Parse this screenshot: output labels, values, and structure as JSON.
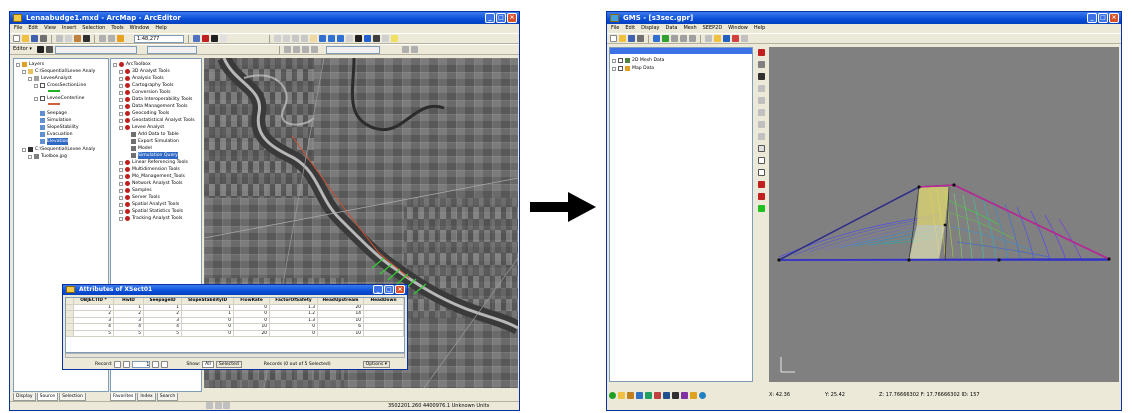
{
  "arcmap": {
    "title": "Lenaabudge1.mxd - ArcMap - ArcEditor",
    "menu": [
      "File",
      "Edit",
      "View",
      "Insert",
      "Selection",
      "Tools",
      "Window",
      "Help"
    ],
    "scale": "1:48,277",
    "editor_label": "Editor ▾",
    "toc": {
      "items": [
        "Layers",
        "C:\\Sequential\\Levee Analy",
        "LeveeAnalyst",
        "CrossSectionLine",
        "LeveeCenterline",
        "Seepage",
        "Simulation",
        "SlopeStability",
        "Evacuation",
        "Elevation",
        "C:\\Sequential\\Levee Analy",
        "Tuolbox.jpg"
      ],
      "tabs": [
        "Display",
        "Source",
        "Selection"
      ]
    },
    "toolbox": {
      "items": [
        "ArcToolbox",
        "3D Analyst Tools",
        "Analysis Tools",
        "Cartography Tools",
        "Conversion Tools",
        "Data Interoperability Tools",
        "Data Management Tools",
        "Geocoding Tools",
        "Geostatistical Analyst Tools",
        "Levee Analyst",
        "Add Data to Table",
        "Export Simulation",
        "Model",
        "Simulation Query",
        "Linear Referencing Tools",
        "Multidimension Tools",
        "Mo_Management_Tools",
        "Network Analyst Tools",
        "Samples",
        "Server Tools",
        "Spatial Analyst Tools",
        "Spatial Statistics Tools",
        "Tracking Analyst Tools"
      ],
      "tabs": [
        "Favorites",
        "Index",
        "Search"
      ]
    },
    "attributes": {
      "title": "Attributes of XSect01",
      "columns": [
        "OBJECTID *",
        "HwID",
        "SeepageID",
        "SlopeStabilityID",
        "FlowRate",
        "FactorOfSafety",
        "HeadUpstream",
        "HeadDown"
      ],
      "rows": [
        [
          "1",
          "1",
          "1",
          "1",
          "0",
          "1.3",
          "20",
          ""
        ],
        [
          "2",
          "2",
          "2",
          "1",
          "0",
          "1.2",
          "14",
          ""
        ],
        [
          "3",
          "3",
          "3",
          "0",
          "0",
          "1.3",
          "10",
          ""
        ],
        [
          "4",
          "4",
          "4",
          "0",
          "10",
          "0",
          "6",
          ""
        ],
        [
          "5",
          "5",
          "5",
          "0",
          "20",
          "0",
          "10",
          ""
        ]
      ],
      "footer": {
        "record_label": "Record:",
        "record_value": "1",
        "show_label": "Show:",
        "all_btn": "All",
        "selected_btn": "Selected",
        "records_text": "Records (0 out of 5 Selected)",
        "options_btn": "Options ▾"
      }
    },
    "status": "3502201.260  4400976.1  Unknown Units"
  },
  "arrow_color": "#000000",
  "gms": {
    "title": "GMS - [s3sec.gpr]",
    "menu": [
      "File",
      "Edit",
      "Display",
      "Data",
      "Mesh",
      "SEEP2D",
      "Window",
      "Help"
    ],
    "tree": {
      "items": [
        "2D Mesh Data",
        "Map Data"
      ]
    },
    "status": {
      "x": "X: 42.36",
      "y": "Y: 25.42",
      "z": "Z: 17.76666302  F: 17.76666302  ID: 157"
    },
    "colors": {
      "mesh_edge": "#3030c8",
      "top_edge": "#c02890"
    }
  }
}
